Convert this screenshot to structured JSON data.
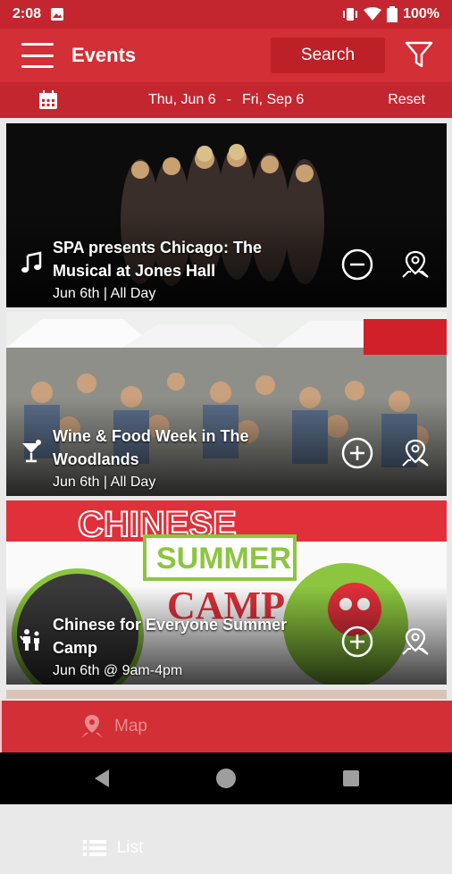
{
  "status_bar": {
    "time": "2:08",
    "battery": "100%"
  },
  "app_bar": {
    "title": "Events",
    "search_label": "Search"
  },
  "date_bar": {
    "start": "Thu, Jun 6",
    "separator": "-",
    "end": "Fri, Sep 6",
    "reset_label": "Reset"
  },
  "events": [
    {
      "title": "SPA presents Chicago: The Musical at Jones Hall",
      "date": "Jun 6th | All Day",
      "category_icon": "music-note-icon",
      "action_icon": "minus-circle-icon"
    },
    {
      "title": "Wine & Food Week in The Woodlands",
      "date": "Jun 6th | All Day",
      "category_icon": "cocktail-icon",
      "action_icon": "plus-circle-icon"
    },
    {
      "title": "Chinese for Everyone Summer Camp",
      "date": "Jun 6th @ 9am-4pm",
      "category_icon": "family-icon",
      "action_icon": "plus-circle-icon"
    }
  ],
  "bottom_tabs": {
    "list_label": "List",
    "map_label": "Map"
  },
  "colors": {
    "primary": "#d32f36",
    "dark": "#c4262f",
    "search_bg": "#bd2027"
  }
}
